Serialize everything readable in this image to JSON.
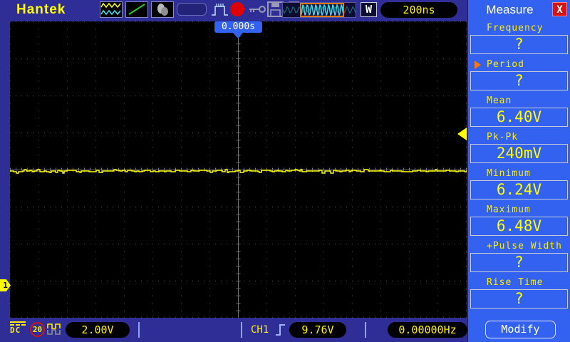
{
  "brand": "Hantek",
  "topbar": {
    "timebase": "200ns",
    "window_button": "W",
    "icons": [
      "channel-waveforms-icon",
      "cursor-line-icon",
      "hand-icon",
      "capture-field",
      "peak-detect-icon",
      "record-icon",
      "lock-key-icon",
      "save-icon",
      "print-icon"
    ]
  },
  "time_cursor": {
    "label": "0.000s"
  },
  "measure_panel": {
    "title": "Measure",
    "close": "X",
    "items": [
      {
        "label": "Frequency",
        "value": "?"
      },
      {
        "label": "Period",
        "value": "?",
        "selected": true
      },
      {
        "label": "Mean",
        "value": "6.40V"
      },
      {
        "label": "Pk-Pk",
        "value": "240mV"
      },
      {
        "label": "Minimum",
        "value": "6.24V"
      },
      {
        "label": "Maximum",
        "value": "6.48V"
      },
      {
        "label": "+Pulse Width",
        "value": "?"
      },
      {
        "label": "Rise Time",
        "value": "?"
      }
    ],
    "modify": "Modify"
  },
  "channel_status": {
    "marker": "1",
    "coupling": "DC",
    "bandwidth_limit": "20",
    "volts_per_div": "2.00V"
  },
  "trigger_status": {
    "source": "CH1",
    "slope": "rising",
    "level": "9.76V",
    "frequency": "0.00000Hz"
  },
  "waveform": {
    "type": "line",
    "description": "flat noisy DC trace, CH1",
    "mean_v": 6.4,
    "pkpk_v": 0.24,
    "min_v": 6.24,
    "max_v": 6.48,
    "volts_per_div": 2.0,
    "timebase_per_div": "200ns",
    "time_offset_s": 0.0,
    "trigger_level_v": 9.76,
    "divisions": {
      "horizontal": 16,
      "vertical": 8
    }
  },
  "colors": {
    "navy": "#2e2e96",
    "panel_blue": "#3361f0",
    "accent_yellow": "#ffff00",
    "trace": "#ffff00",
    "record_red": "#e00000",
    "close_red": "#d61414",
    "preview_highlight": "#e07818",
    "preview_cyan": "#35e0f0"
  }
}
